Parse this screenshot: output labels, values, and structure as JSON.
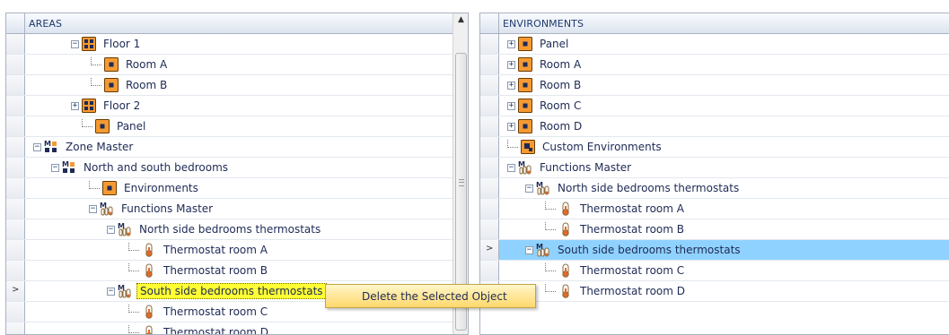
{
  "left": {
    "header": "AREAS",
    "rows": [
      {
        "label": "Floor 1",
        "icon": "floor",
        "exp": "−"
      },
      {
        "label": "Room A",
        "icon": "room"
      },
      {
        "label": "Room B",
        "icon": "room"
      },
      {
        "label": "Floor 2",
        "icon": "floor",
        "exp": "+"
      },
      {
        "label": "Panel",
        "icon": "room"
      },
      {
        "label": "Zone Master",
        "icon": "master",
        "exp": "−"
      },
      {
        "label": "North and south bedrooms",
        "icon": "master",
        "exp": "−"
      },
      {
        "label": "Environments",
        "icon": "room"
      },
      {
        "label": "Functions Master",
        "icon": "funcmaster",
        "exp": "−"
      },
      {
        "label": "North side bedrooms thermostats",
        "icon": "funcmaster",
        "exp": "−"
      },
      {
        "label": "Thermostat room A",
        "icon": "thermo"
      },
      {
        "label": "Thermostat room B",
        "icon": "thermo"
      },
      {
        "label": "South side bedrooms thermostats",
        "icon": "funcmaster",
        "exp": "−",
        "selected": true
      },
      {
        "label": "Thermostat room C",
        "icon": "thermo"
      },
      {
        "label": "Thermostat room D",
        "icon": "thermo"
      }
    ]
  },
  "right": {
    "header": "ENVIRONMENTS",
    "rows": [
      {
        "label": "Panel",
        "icon": "room",
        "exp": "+"
      },
      {
        "label": "Room A",
        "icon": "room",
        "exp": "+"
      },
      {
        "label": "Room B",
        "icon": "room",
        "exp": "+"
      },
      {
        "label": "Room C",
        "icon": "room",
        "exp": "+"
      },
      {
        "label": "Room D",
        "icon": "room",
        "exp": "+"
      },
      {
        "label": "Custom Environments",
        "icon": "custom"
      },
      {
        "label": "Functions Master",
        "icon": "funcmaster",
        "exp": "−"
      },
      {
        "label": "North side bedrooms thermostats",
        "icon": "funcmaster",
        "exp": "−"
      },
      {
        "label": "Thermostat room A",
        "icon": "thermo"
      },
      {
        "label": "Thermostat room B",
        "icon": "thermo"
      },
      {
        "label": "South side bedrooms thermostats",
        "icon": "funcmaster",
        "exp": "−",
        "selected": true
      },
      {
        "label": "Thermostat room C",
        "icon": "thermo"
      },
      {
        "label": "Thermostat room D",
        "icon": "thermo"
      }
    ]
  },
  "context_menu": {
    "item": "Delete the Selected Object"
  },
  "colors": {
    "left_selected": "#ffff33",
    "right_selected": "#8fd2ff",
    "room_icon": "#f59a33",
    "context_menu": "#ffd86b"
  }
}
